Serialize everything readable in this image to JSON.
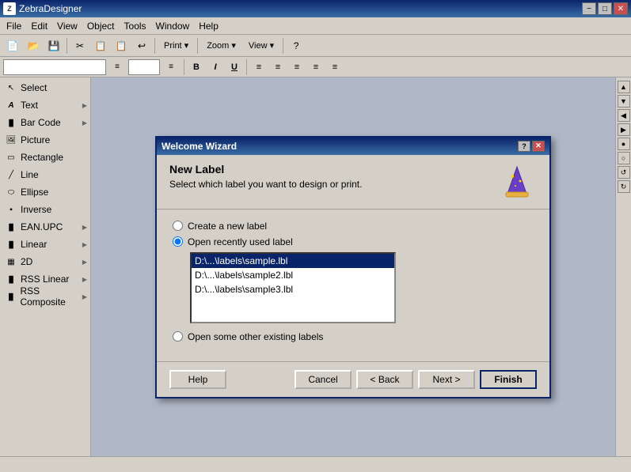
{
  "app": {
    "title": "ZebraDesigner",
    "icon_label": "Z"
  },
  "title_buttons": {
    "minimize": "−",
    "maximize": "□",
    "close": "✕"
  },
  "menu": {
    "items": [
      "File",
      "Edit",
      "View",
      "Object",
      "Tools",
      "Window",
      "Help"
    ]
  },
  "toolbar": {
    "buttons": [
      "📄",
      "📂",
      "💾",
      "✂",
      "📋",
      "📋",
      "🔄",
      "🖨"
    ],
    "print_label": "Print ▾",
    "zoom_label": "Zoom ▾",
    "view_label": "View ▾",
    "help_icon": "?"
  },
  "toolbar2": {
    "font_combo": "",
    "size_combo": "",
    "bold": "B",
    "italic": "I",
    "underline": "U",
    "align_btns": [
      "≡",
      "≡",
      "≡",
      "≡",
      "≡"
    ]
  },
  "sidebar": {
    "items": [
      {
        "id": "select",
        "label": "Select",
        "icon": "↖"
      },
      {
        "id": "text",
        "label": "Text",
        "icon": "A",
        "has_arrow": true
      },
      {
        "id": "barcode",
        "label": "Bar Code",
        "icon": "▐▌",
        "has_arrow": true
      },
      {
        "id": "picture",
        "label": "Picture",
        "icon": "🖼"
      },
      {
        "id": "rectangle",
        "label": "Rectangle",
        "icon": "▭"
      },
      {
        "id": "line",
        "label": "Line",
        "icon": "╱"
      },
      {
        "id": "ellipse",
        "label": "Ellipse",
        "icon": "⬭"
      },
      {
        "id": "inverse",
        "label": "Inverse",
        "icon": "▪"
      },
      {
        "id": "ean-upc",
        "label": "EAN.UPC",
        "icon": "▐▌",
        "has_arrow": true
      },
      {
        "id": "linear",
        "label": "Linear",
        "icon": "▐▌",
        "has_arrow": true
      },
      {
        "id": "2d",
        "label": "2D",
        "icon": "▦",
        "has_arrow": true
      },
      {
        "id": "rss-linear",
        "label": "RSS Linear",
        "icon": "▐▌",
        "has_arrow": true
      },
      {
        "id": "rss-composite",
        "label": "RSS Composite",
        "icon": "▐▌",
        "has_arrow": true
      }
    ]
  },
  "dialog": {
    "title": "Welcome Wizard",
    "header": {
      "title": "New Label",
      "subtitle": "Select which label you want to design or print."
    },
    "options": {
      "create_new": "Create a new label",
      "open_recent": "Open recently used label",
      "open_other": "Open some other existing labels"
    },
    "recent_files": [
      "D:\\...\\labels\\sample.lbl",
      "D:\\...\\labels\\sample2.lbl",
      "D:\\...\\labels\\sample3.lbl"
    ],
    "selected_option": "open_recent",
    "selected_file_index": 0,
    "buttons": {
      "help": "Help",
      "cancel": "Cancel",
      "back": "< Back",
      "next": "Next >",
      "finish": "Finish"
    }
  },
  "right_sidebar_buttons": [
    "▲",
    "▼",
    "◀",
    "▶",
    "●",
    "○",
    "↺",
    "↻"
  ],
  "status_bar": {
    "text": ""
  }
}
